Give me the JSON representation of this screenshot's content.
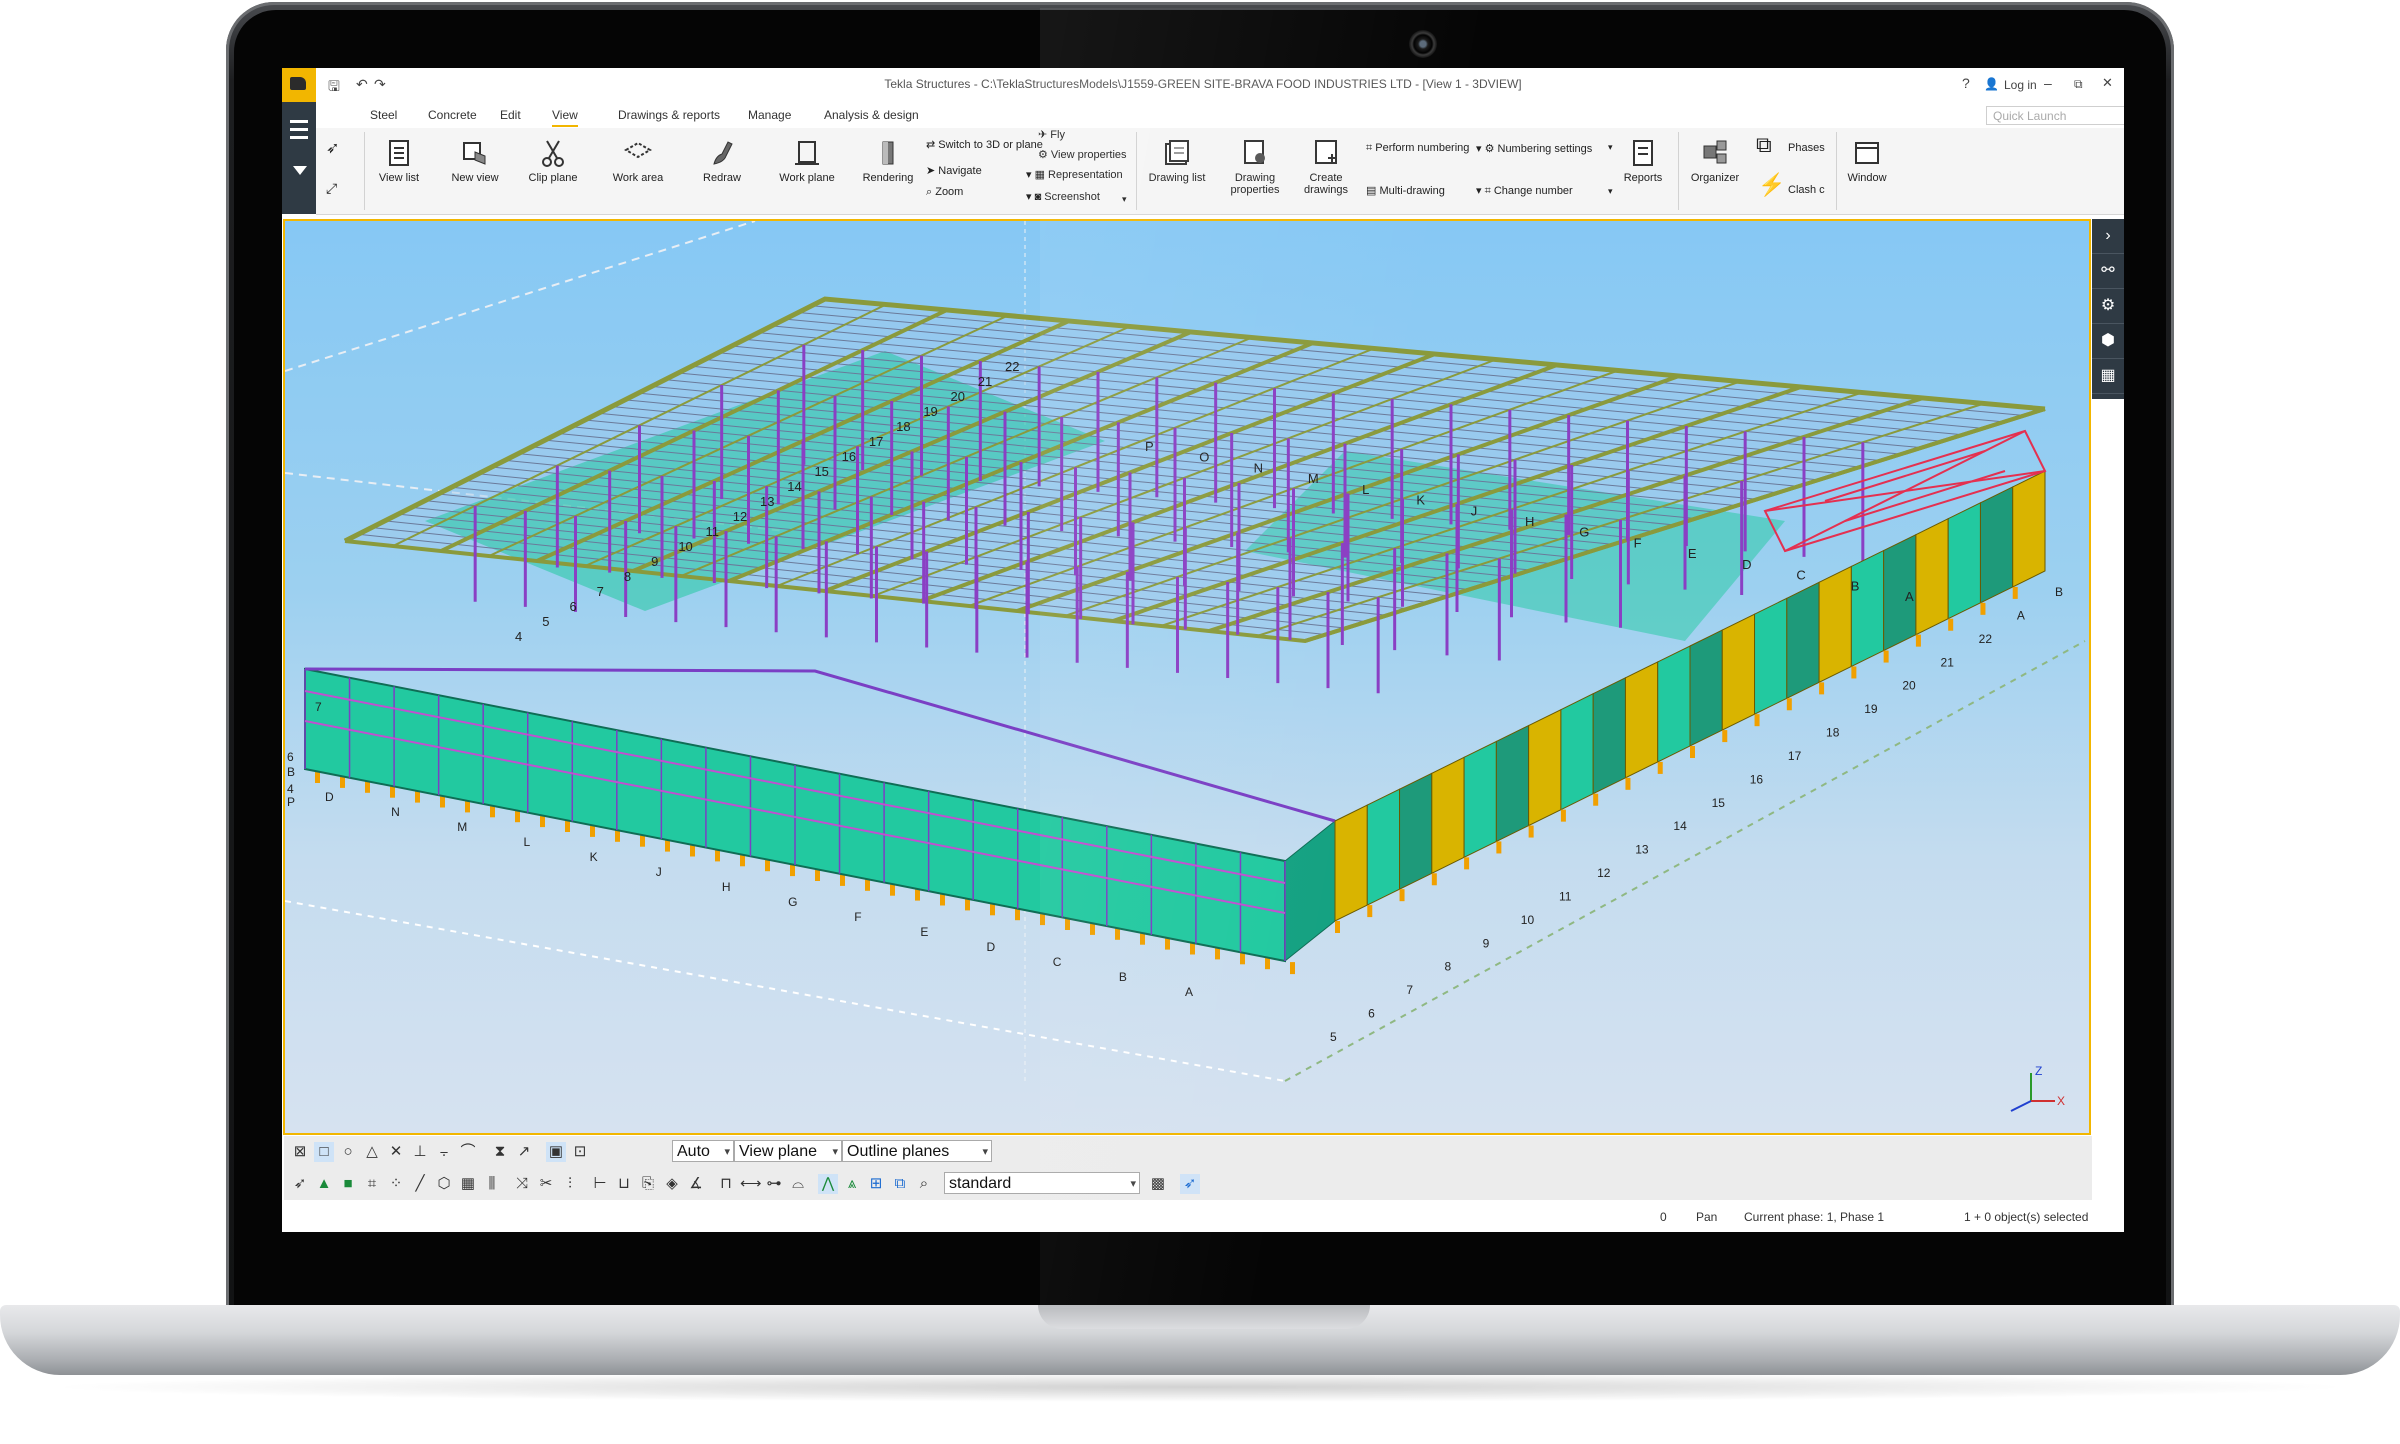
{
  "titlebar": {
    "title": "Tekla Structures - C:\\TeklaStructuresModels\\J1559-GREEN SITE-BRAVA FOOD INDUSTRIES LTD - [View 1 - 3DVIEW]",
    "login": "Log in",
    "help": "?",
    "minimize": "–",
    "restore": "⧉",
    "close": "✕"
  },
  "tabs": [
    "Steel",
    "Concrete",
    "Edit",
    "View",
    "Drawings & reports",
    "Manage",
    "Analysis & design"
  ],
  "active_tab": "View",
  "quick_launch_placeholder": "Quick Launch",
  "ribbon": {
    "view_list": "View list",
    "new_view": "New view",
    "clip_plane": "Clip plane",
    "work_area": "Work area",
    "redraw": "Redraw",
    "work_plane": "Work plane",
    "rendering": "Rendering",
    "switch_3d": "Switch to 3D or plane",
    "navigate": "Navigate",
    "zoom": "Zoom",
    "fly": "Fly",
    "view_properties": "View properties",
    "representation": "Representation",
    "screenshot": "Screenshot",
    "drawing_list": "Drawing list",
    "drawing_properties_1": "Drawing",
    "drawing_properties_2": "properties",
    "create_drawings_1": "Create",
    "create_drawings_2": "drawings",
    "perform_numbering": "Perform numbering",
    "numbering_settings": "Numbering settings",
    "multi_drawing": "Multi-drawing",
    "change_number": "Change number",
    "reports": "Reports",
    "organizer": "Organizer",
    "phases": "Phases",
    "clash": "Clash c",
    "window": "Window"
  },
  "viewport": {
    "grid_labels_long": [
      "22",
      "21",
      "20",
      "19",
      "18",
      "17",
      "16",
      "15",
      "14",
      "13",
      "12",
      "11",
      "10",
      "9",
      "8",
      "7",
      "6",
      "5",
      "4"
    ],
    "grid_labels_letters": [
      "P",
      "O",
      "N",
      "M",
      "L",
      "K",
      "J",
      "H",
      "G",
      "F",
      "E",
      "D",
      "C",
      "B",
      "A"
    ],
    "right_labels": [
      "B",
      "A",
      "22",
      "21",
      "20",
      "19",
      "18",
      "17",
      "16",
      "15",
      "14",
      "13",
      "12",
      "11",
      "10",
      "9",
      "8",
      "7",
      "6",
      "5"
    ],
    "front_labels": [
      "D",
      "N",
      "M",
      "L",
      "K",
      "J",
      "H",
      "G",
      "F",
      "E",
      "D",
      "C",
      "B",
      "A"
    ],
    "left_labels": [
      "7",
      "6",
      "B",
      "4",
      "P"
    ]
  },
  "toolbar": {
    "auto": "Auto",
    "view_plane": "View plane",
    "outline_planes": "Outline planes",
    "standard": "standard"
  },
  "status": {
    "zero": "0",
    "pan": "Pan",
    "phase": "Current phase: 1, Phase 1",
    "selected": "1 + 0 object(s) selected"
  },
  "colors": {
    "accent": "#f2b600",
    "sidebar": "#2f3a44",
    "steel_purple": "#8a3fc4",
    "cladding": "#22c9a0",
    "column_yellow": "#d9b400",
    "truss_olive": "#8a9a3c",
    "bracing_red": "#e43050"
  }
}
